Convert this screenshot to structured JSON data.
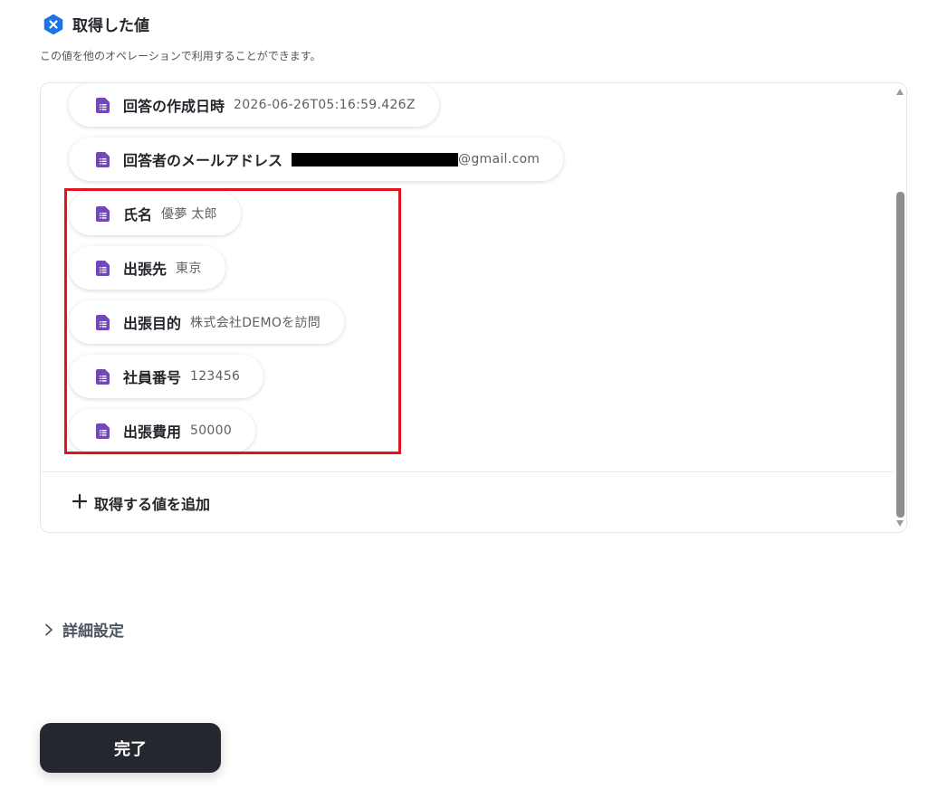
{
  "header": {
    "title": "取得した値",
    "icon": "yoom-badge-icon",
    "icon_color": "#1a73e8"
  },
  "subtitle": "この値を他のオペレーションで利用することができます。",
  "fields": [
    {
      "label": "回答の作成日時",
      "value": "2026-06-26T05:16:59.426Z",
      "icon": "google-forms-icon"
    },
    {
      "label": "回答者のメールアドレス",
      "value": "@gmail.com",
      "redacted_prefix": true,
      "icon": "google-forms-icon"
    },
    {
      "label": "氏名",
      "value": "優夢 太郎",
      "icon": "google-forms-icon"
    },
    {
      "label": "出張先",
      "value": "東京",
      "icon": "google-forms-icon"
    },
    {
      "label": "出張目的",
      "value": "株式会社DEMOを訪問",
      "icon": "google-forms-icon"
    },
    {
      "label": "社員番号",
      "value": "123456",
      "icon": "google-forms-icon"
    },
    {
      "label": "出張費用",
      "value": "50000",
      "icon": "google-forms-icon"
    }
  ],
  "add_value": {
    "icon": "plus-icon",
    "label": "取得する値を追加"
  },
  "advanced": {
    "icon": "chevron-right-icon",
    "label": "詳細設定"
  },
  "done_button": {
    "label": "完了"
  },
  "colors": {
    "forms_purple": "#7248b9",
    "highlight_red": "#e0141e",
    "button_dark": "#24272d"
  }
}
